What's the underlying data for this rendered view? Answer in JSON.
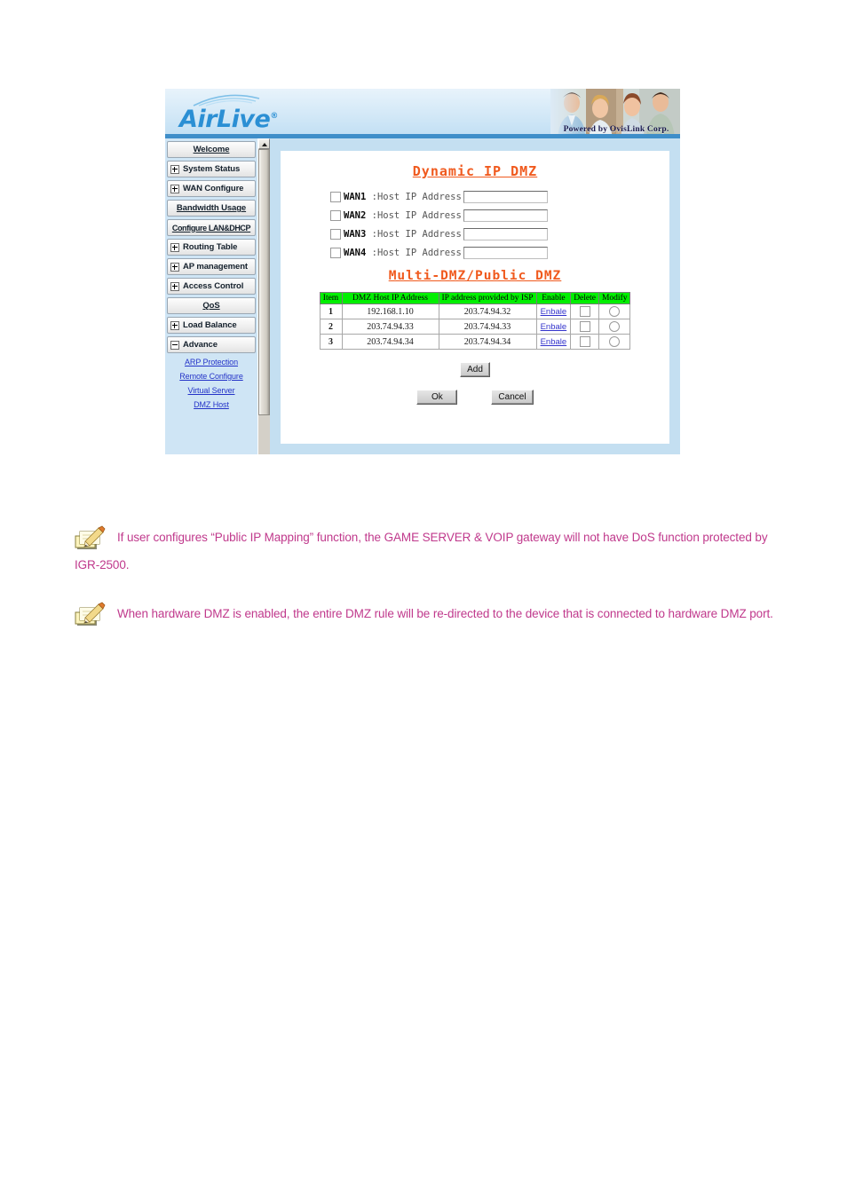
{
  "document": {
    "notes": [
      {
        "icon": "note-pencil-icon",
        "text": "If user configures “Public IP Mapping” function, the GAME SERVER & VOIP gateway will not have DoS function protected by IGR-2500."
      },
      {
        "icon": "note-pencil-icon",
        "text": "When hardware DMZ is enabled, the entire DMZ rule will be re-directed to the device that is connected to hardware DMZ port."
      }
    ]
  },
  "router_ui": {
    "header": {
      "brand": "AirLive",
      "brand_reg": "®",
      "banner_caption": "Powered by OvisLink Corp."
    },
    "sidebar": {
      "items": [
        {
          "label": "Welcome",
          "expander": "none",
          "style": "centered"
        },
        {
          "label": "System Status",
          "expander": "plus",
          "style": "left"
        },
        {
          "label": "WAN Configure",
          "expander": "plus",
          "style": "left"
        },
        {
          "label": "Bandwidth Usage",
          "expander": "none",
          "style": "centered"
        },
        {
          "label": "Configure LAN&DHCP",
          "expander": "none",
          "style": "centered-wide"
        },
        {
          "label": "Routing Table",
          "expander": "plus",
          "style": "left"
        },
        {
          "label": "AP management",
          "expander": "plus",
          "style": "left"
        },
        {
          "label": "Access Control",
          "expander": "plus",
          "style": "left"
        },
        {
          "label": "QoS",
          "expander": "none",
          "style": "centered"
        },
        {
          "label": "Load Balance",
          "expander": "plus",
          "style": "left"
        },
        {
          "label": "Advance",
          "expander": "minus",
          "style": "left"
        }
      ],
      "sub_items": [
        {
          "label": "ARP Protection"
        },
        {
          "label": "Remote Configure"
        },
        {
          "label": "Virtual Server"
        },
        {
          "label": "DMZ Host"
        }
      ]
    },
    "main": {
      "heading_1": "Dynamic IP DMZ",
      "heading_2": "Multi-DMZ/Public DMZ",
      "wan_rows": [
        {
          "name": "WAN1",
          "rest": " :Host IP Address",
          "value": "",
          "checked": false
        },
        {
          "name": "WAN2",
          "rest": " :Host IP Address",
          "value": "",
          "checked": false
        },
        {
          "name": "WAN3",
          "rest": " :Host IP Address",
          "value": "",
          "checked": false
        },
        {
          "name": "WAN4",
          "rest": " :Host IP Address",
          "value": "",
          "checked": false
        }
      ],
      "table": {
        "headers": [
          "Item",
          "DMZ Host IP Address",
          "IP address provided by ISP",
          "Enable",
          "Delete",
          "Modify"
        ],
        "rows": [
          {
            "item": "1",
            "dmz_host_ip": "192.168.1.10",
            "isp_ip": "203.74.94.32",
            "enable_link": "Enbale",
            "delete_checked": false,
            "modify_selected": false
          },
          {
            "item": "2",
            "dmz_host_ip": "203.74.94.33",
            "isp_ip": "203.74.94.33",
            "enable_link": "Enbale",
            "delete_checked": false,
            "modify_selected": false
          },
          {
            "item": "3",
            "dmz_host_ip": "203.74.94.34",
            "isp_ip": "203.74.94.34",
            "enable_link": "Enbale",
            "delete_checked": false,
            "modify_selected": false
          }
        ]
      },
      "buttons": {
        "add": "Add",
        "ok": "Ok",
        "cancel": "Cancel"
      }
    },
    "colors": {
      "heading_orange": "#f05a1e",
      "table_header_green": "#00ef00",
      "brand_blue": "#2b8fd4",
      "panel_blue": "#c4dff1",
      "sidebar_blue": "#cfe5f5",
      "link_blue": "#2433c8",
      "note_magenta": "#c0398c"
    }
  }
}
